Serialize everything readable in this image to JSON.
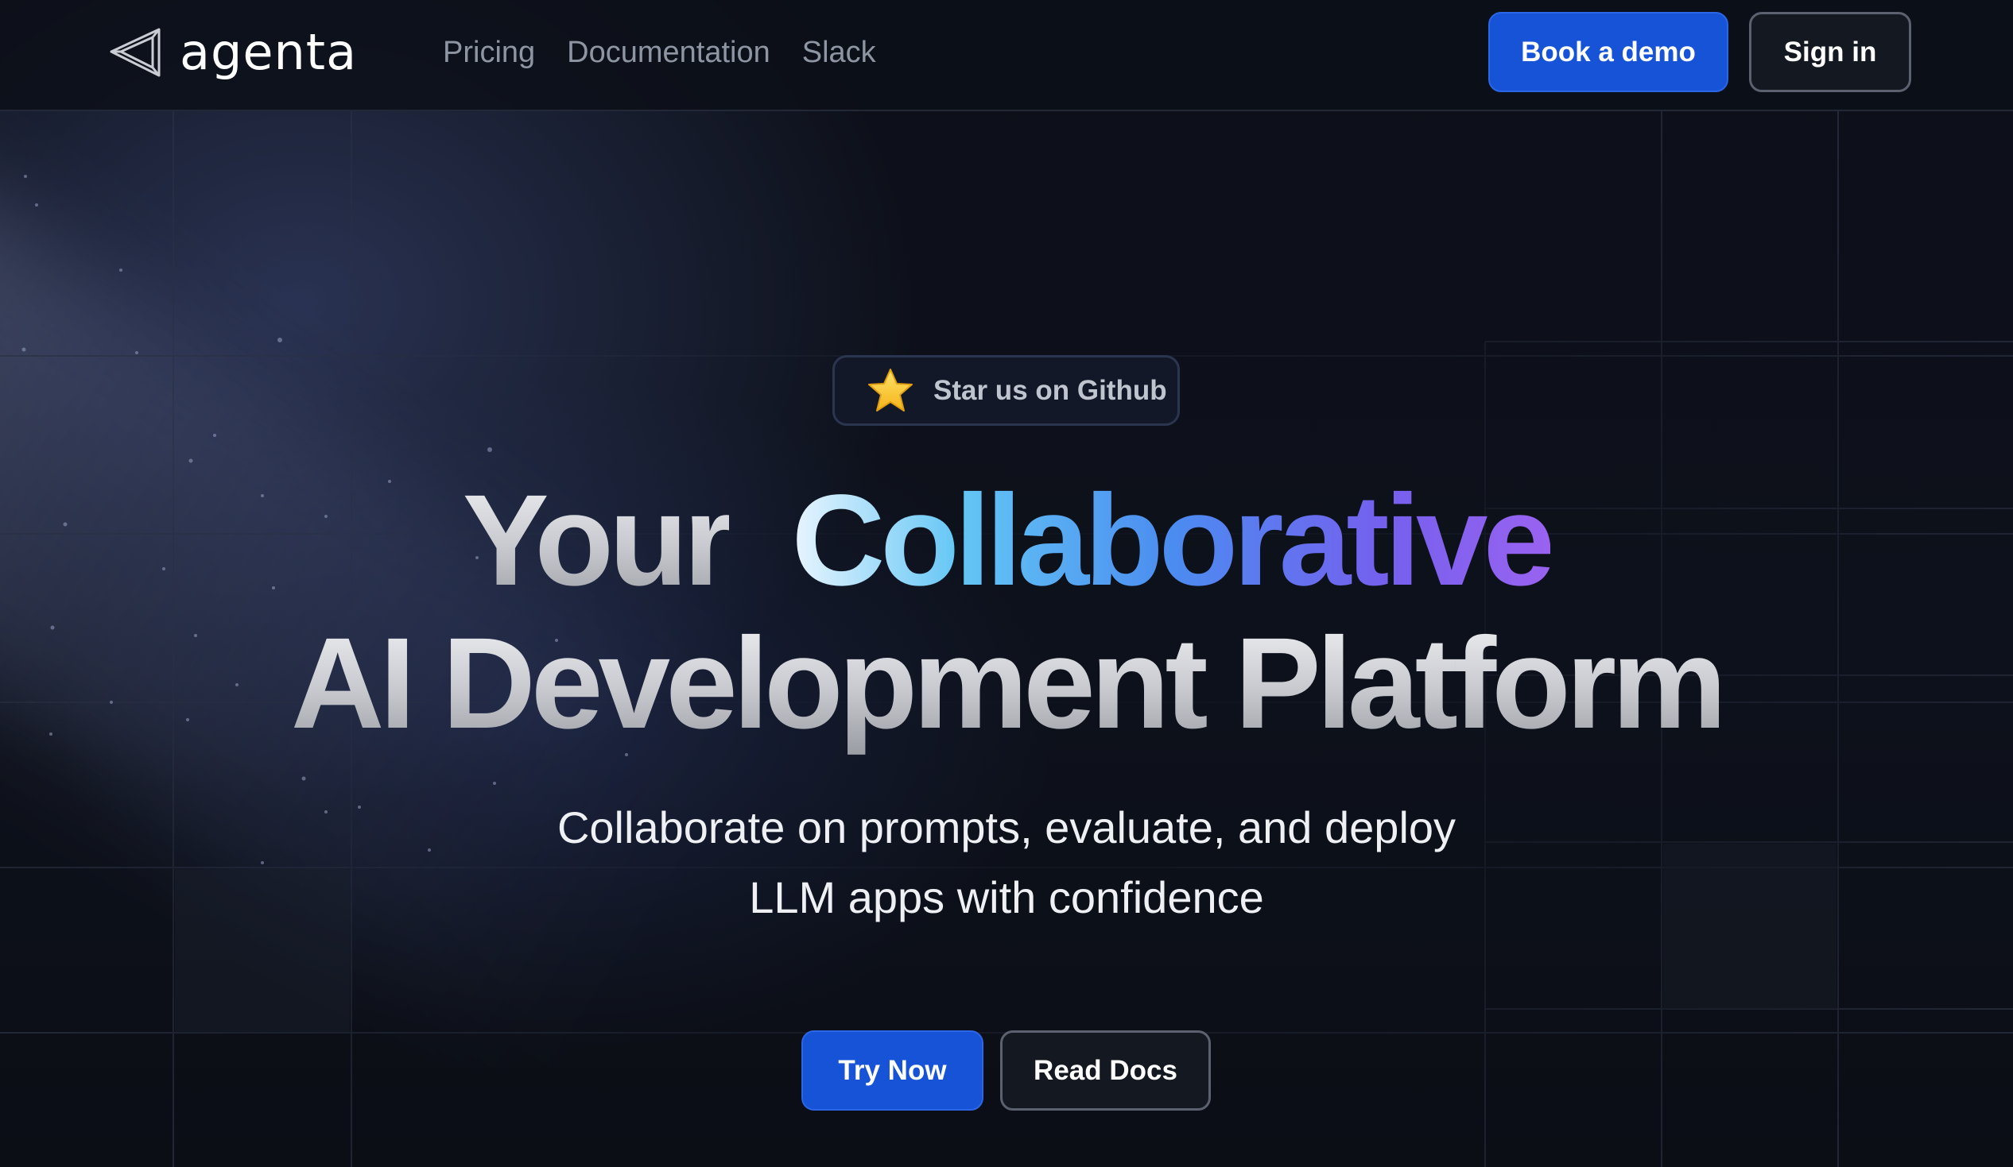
{
  "nav": {
    "logo_text": "agenta",
    "links": [
      "Pricing",
      "Documentation",
      "Slack"
    ],
    "book_demo_label": "Book a demo",
    "sign_in_label": "Sign in"
  },
  "hero": {
    "github_pill_label": "Star us on Github",
    "github_pill_icon": "star-icon",
    "headline_line1_a": "Your",
    "headline_line1_b": "Collaborative",
    "headline_line2": "AI Development Platform",
    "subtitle_line1": "Collaborate on prompts, evaluate, and deploy",
    "subtitle_line2": "LLM apps with confidence",
    "try_now_label": "Try Now",
    "read_docs_label": "Read Docs"
  },
  "colors": {
    "primary_button": "#1753d6",
    "background": "#0c0f17",
    "accent_gradient_start": "#63c6f5",
    "accent_gradient_end": "#9a62f0"
  }
}
